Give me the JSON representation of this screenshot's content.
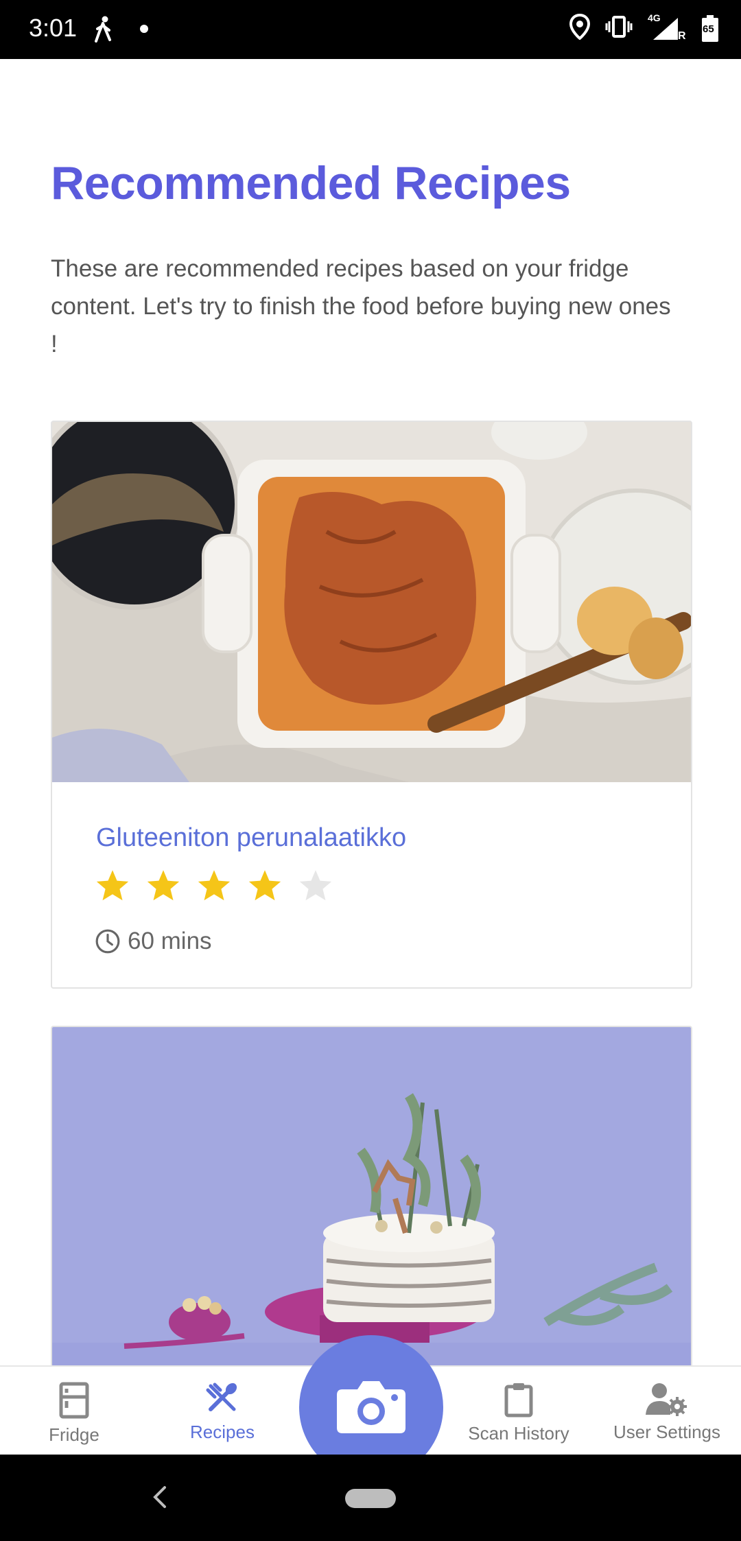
{
  "status_bar": {
    "time": "3:01",
    "network_label": "4G",
    "roaming_label": "R",
    "battery_level": "65"
  },
  "header": {
    "title": "Recommended Recipes",
    "description": "These are recommended recipes based on your fridge content. Let's try to finish the food before buying new ones !"
  },
  "recipes": [
    {
      "title": "Gluteeniton perunalaatikko",
      "rating": 4,
      "rating_max": 5,
      "duration": "60 mins"
    }
  ],
  "bottom_nav": {
    "items": [
      {
        "label": "Fridge",
        "icon": "fridge-icon"
      },
      {
        "label": "Recipes",
        "icon": "utensils-icon",
        "active": true
      },
      {
        "label": "Scan History",
        "icon": "clipboard-icon"
      },
      {
        "label": "User Settings",
        "icon": "user-gear-icon"
      }
    ],
    "fab_icon": "camera-icon"
  },
  "colors": {
    "accent": "#5b5bdc",
    "link": "#5a6fd8",
    "star_on": "#f5c518",
    "star_off": "#e6e6e6",
    "fab": "#6a7de0"
  }
}
